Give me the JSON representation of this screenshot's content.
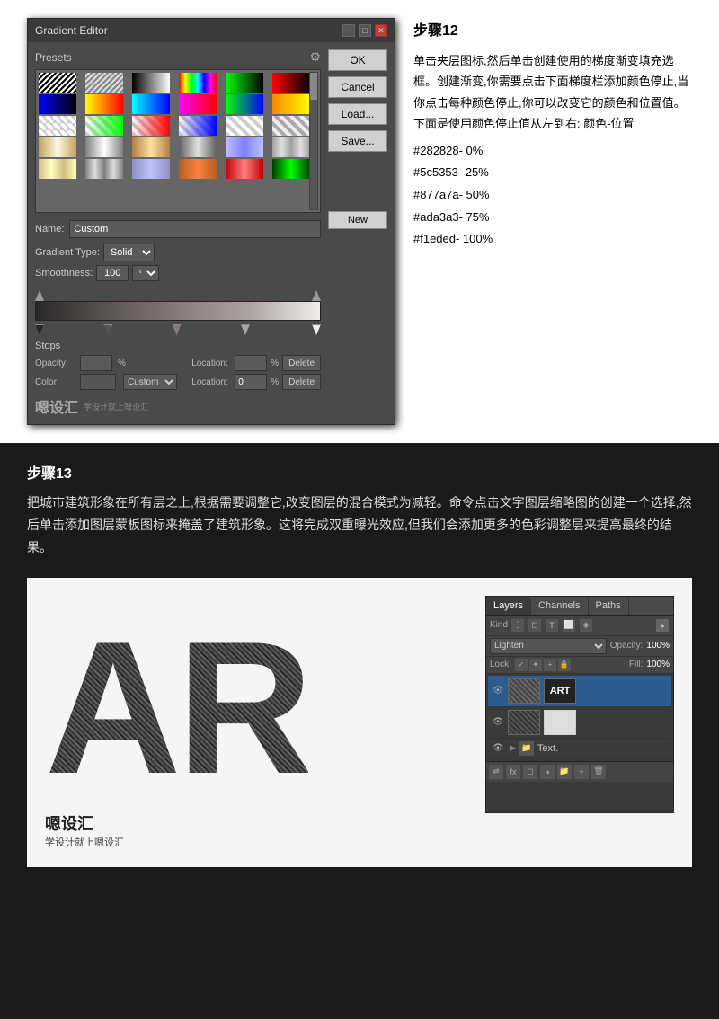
{
  "page": {
    "bg": "#1a1a1a"
  },
  "dialog": {
    "title": "Gradient Editor",
    "presets_label": "Presets",
    "name_label": "Name:",
    "name_value": "Custom",
    "gradient_type_label": "Gradient Type:",
    "gradient_type_value": "Solid",
    "smoothness_label": "Smoothness:",
    "smoothness_value": "100",
    "smoothness_unit": "%",
    "stops_label": "Stops",
    "opacity_label": "Opacity:",
    "opacity_unit": "%",
    "location_label": "Location:",
    "location_value": "0",
    "location_unit": "%",
    "color_label": "Color:",
    "delete_label": "Delete",
    "ok_label": "OK",
    "cancel_label": "Cancel",
    "load_label": "Load...",
    "save_label": "Save...",
    "new_label": "New"
  },
  "step12": {
    "title": "步骤12",
    "body": "单击夹层图标,然后单击创建使用的梯度渐变填充选框。创建渐变,你需要点击下面梯度栏添加颜色停止,当你点击每种颜色停止,你可以改变它的颜色和位置值。下面是使用颜色停止值从左到右: 颜色-位置",
    "colors": "#282828- 0%\n#5c5353- 25%\n#877a7a- 50%\n#ada3a3- 75%\n#f1eded- 100%"
  },
  "step13": {
    "title": "步骤13",
    "body": "把城市建筑形象在所有层之上,根据需要调整它,改变图层的混合模式为减轻。命令点击文字图层缩略图的创建一个选择,然后单击添加图层蒙板图标来掩盖了建筑形象。这将完成双重曝光效应,但我们会添加更多的色彩调整层来提高最终的结果。"
  },
  "layers": {
    "title": "Layers",
    "tabs": [
      "Layers",
      "Channels",
      "Paths"
    ],
    "kind_label": "Kind",
    "blend_mode": "Lighten",
    "opacity_label": "Opacity:",
    "opacity_value": "100%",
    "lock_label": "Lock:",
    "fill_label": "Fill:",
    "fill_value": "100%",
    "items": [
      {
        "name": "ART",
        "type": "art",
        "visible": true
      },
      {
        "name": "",
        "type": "white",
        "visible": true
      },
      {
        "name": "Text.",
        "type": "group",
        "visible": true
      }
    ]
  },
  "watermark": {
    "logo": "嗯设汇",
    "tagline": "学设计就上嗯设汇"
  },
  "letters": "AR"
}
